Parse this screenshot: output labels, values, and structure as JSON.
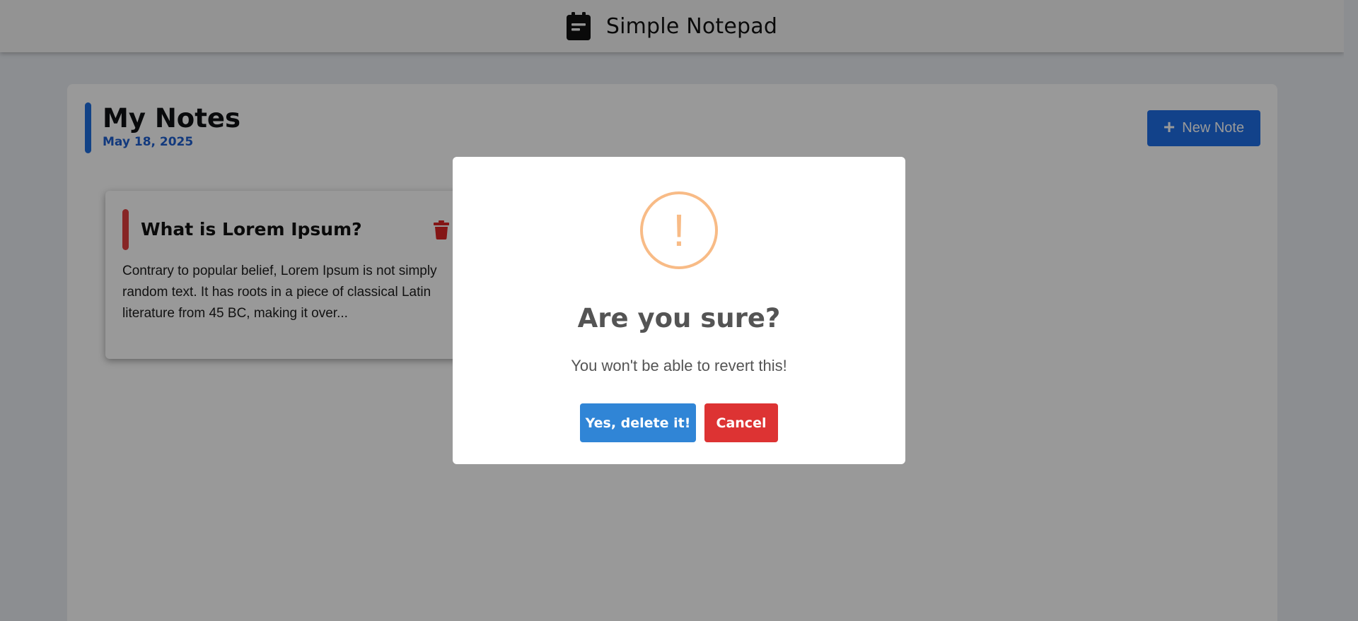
{
  "app": {
    "title": "Simple Notepad",
    "brand_icon": "notepad-icon"
  },
  "notes_panel": {
    "title": "My Notes",
    "date": "May 18, 2025",
    "new_note_label": "New Note",
    "new_note_icon": "plus-icon"
  },
  "notes": [
    {
      "title": "What is Lorem Ipsum?",
      "body": "Contrary to popular belief, Lorem Ipsum is not simply random text. It has roots in a piece of classical Latin literature from 45 BC, making it over...",
      "accent_color": "#e23f3f",
      "delete_icon": "trash-icon"
    }
  ],
  "dialog": {
    "icon": "warning-icon",
    "icon_glyph": "!",
    "title": "Are you sure?",
    "text": "You won't be able to revert this!",
    "confirm_label": "Yes, delete it!",
    "cancel_label": "Cancel"
  },
  "colors": {
    "primary": "#1e6ee6",
    "confirm": "#3085d6",
    "cancel": "#dd3333",
    "warning": "#f8bb86",
    "note_accent": "#e23f3f"
  }
}
